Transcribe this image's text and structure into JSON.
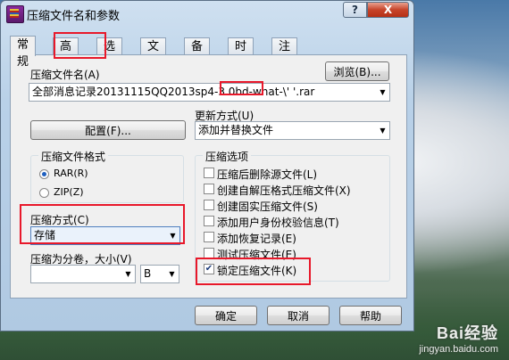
{
  "window": {
    "title": "压缩文件名和参数",
    "help_glyph": "?",
    "close_glyph": "X"
  },
  "tabs": [
    "常规",
    "高级",
    "选项",
    "文件",
    "备份",
    "时间",
    "注释"
  ],
  "archive_name": {
    "label": "压缩文件名(A)",
    "browse_label": "浏览(B)...",
    "value": "全部消息记录20131115QQ2013sp4-3.0bd-what-\\'      '.rar"
  },
  "profiles_button": "配置(F)...",
  "update_mode": {
    "label": "更新方式(U)",
    "value": "添加并替换文件"
  },
  "archive_format": {
    "title": "压缩文件格式",
    "options": [
      "RAR(R)",
      "ZIP(Z)"
    ],
    "selected": "RAR(R)"
  },
  "compression_method": {
    "label": "压缩方式(C)",
    "value": "存储"
  },
  "split_volumes": {
    "label": "压缩为分卷，大小(V)",
    "unit": "B"
  },
  "archive_options": {
    "title": "压缩选项",
    "items": [
      {
        "label": "压缩后删除源文件(L)",
        "checked": false
      },
      {
        "label": "创建自解压格式压缩文件(X)",
        "checked": false
      },
      {
        "label": "创建固实压缩文件(S)",
        "checked": false
      },
      {
        "label": "添加用户身份校验信息(T)",
        "checked": false
      },
      {
        "label": "添加恢复记录(E)",
        "checked": false
      },
      {
        "label": "测试压缩文件(E)",
        "checked": false
      },
      {
        "label": "锁定压缩文件(K)",
        "checked": true
      }
    ]
  },
  "buttons": {
    "ok": "确定",
    "cancel": "取消",
    "help": "帮助"
  },
  "watermark": {
    "line1": "Bai经验",
    "line2": "jingyan.baidu.com"
  },
  "colors": {
    "highlight": "#e8182a",
    "title_close": "#c7442a"
  }
}
